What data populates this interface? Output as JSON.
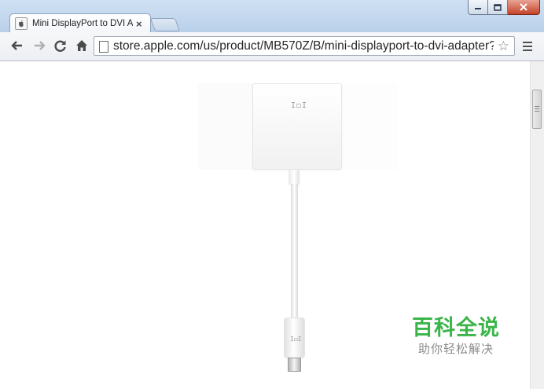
{
  "browser": {
    "tab": {
      "title": "Mini DisplayPort to DVI Ad",
      "close_glyph": "×"
    },
    "omnibox": {
      "url": "store.apple.com/us/product/MB570Z/B/mini-displayport-to-dvi-adapter?fnode"
    },
    "nav": {
      "back_glyph": "←",
      "forward_glyph": "→",
      "reload_glyph": "C",
      "home_glyph": "⌂"
    },
    "star_glyph": "☆",
    "icons": [
      "apple-favicon-icon",
      "back-arrow-icon",
      "forward-arrow-icon",
      "reload-icon",
      "home-icon",
      "page-icon",
      "bookmark-star-icon",
      "menu-icon"
    ]
  },
  "product": {
    "dvi_logo": "I◻I",
    "mini_logo": "I◻I"
  },
  "watermark": {
    "title": "百科全说",
    "subtitle": "助你轻松解决",
    "color": "#3bb54a"
  }
}
